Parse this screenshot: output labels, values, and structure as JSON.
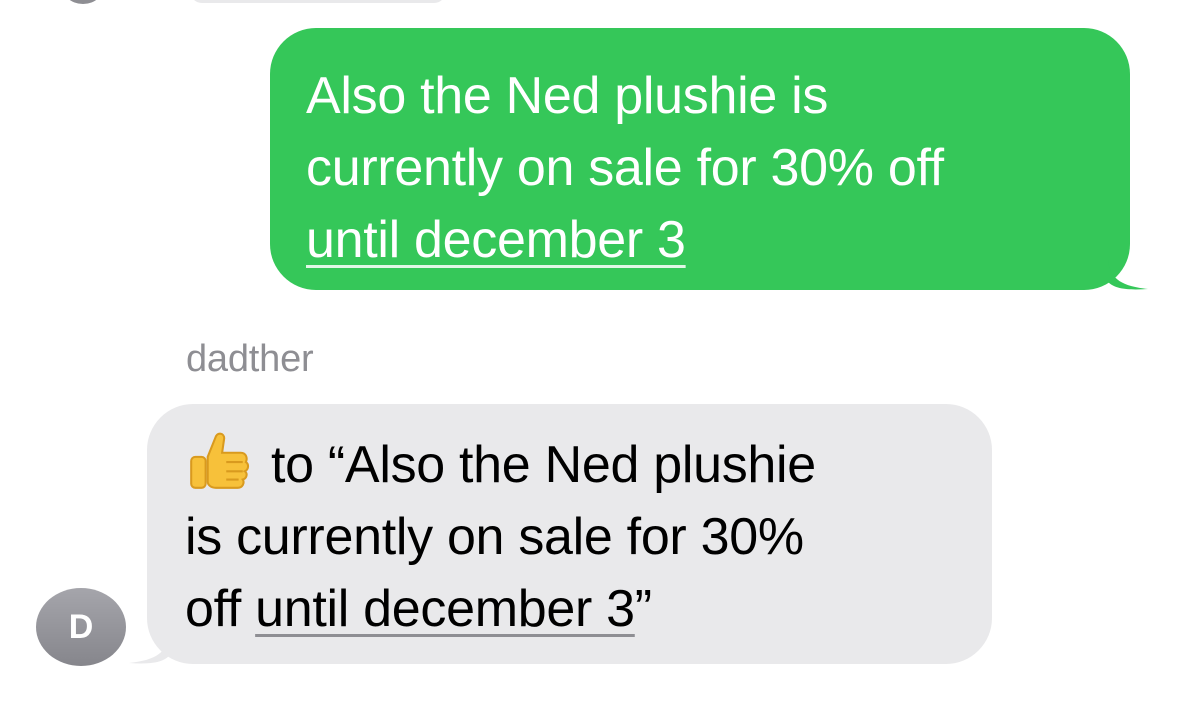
{
  "messages": {
    "sent": {
      "line1": "Also the Ned plushie is",
      "line2": "currently on sale for 30% off",
      "link_text": "until december 3"
    },
    "received": {
      "sender_name": "dadther",
      "reaction_icon": "thumbs-up-emoji",
      "prefix": "to “Also the Ned plushie",
      "line2": "is currently on sale for 30%",
      "line3_start": "off ",
      "link_text": "until december 3",
      "closing_quote": "”"
    }
  },
  "avatar": {
    "initial": "D"
  },
  "colors": {
    "sent_bubble": "#35c759",
    "received_bubble": "#e9e9eb",
    "sender_name": "#8e8e93",
    "avatar": "#8e8e93"
  }
}
